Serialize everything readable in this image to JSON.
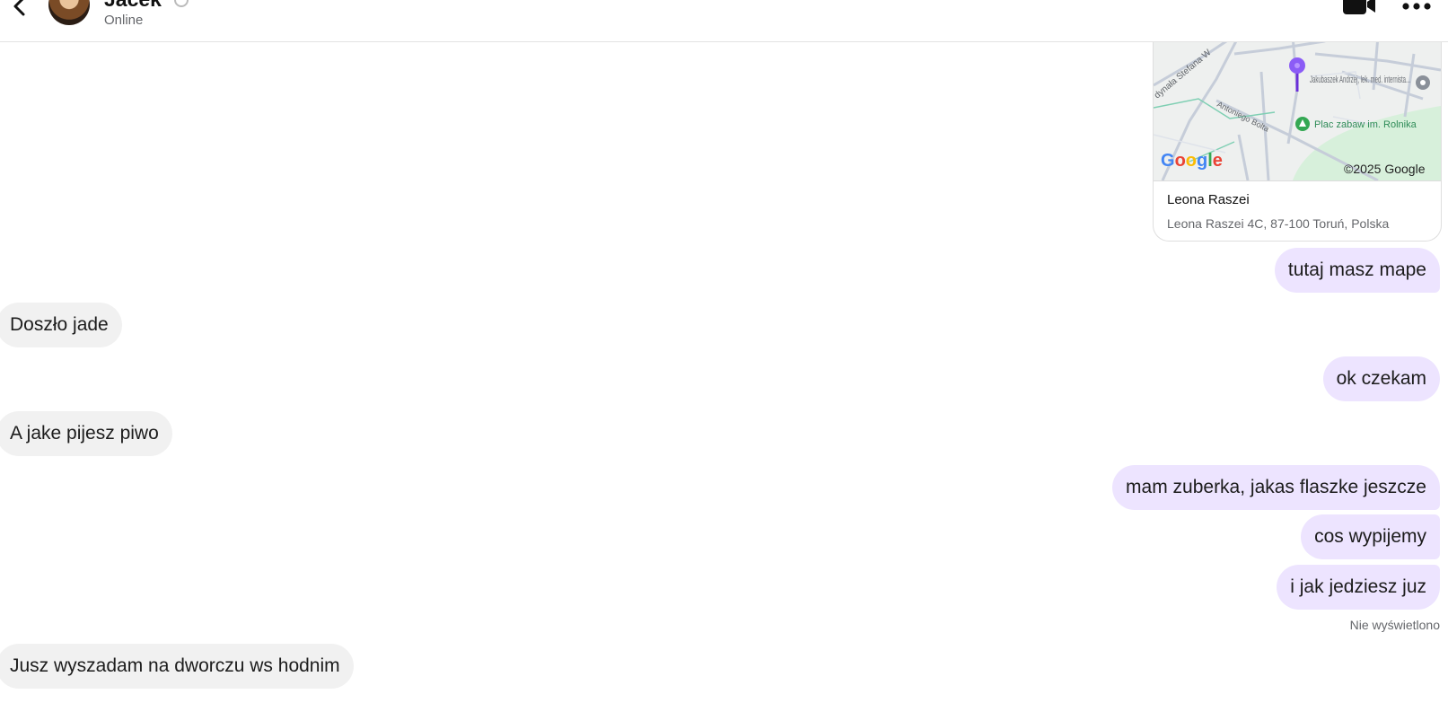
{
  "header": {
    "contact_name": "Jacek",
    "status": "Online",
    "back_icon": "chevron-left-icon",
    "video_icon": "video-camera-icon",
    "more_icon": "ellipsis-icon"
  },
  "map_card": {
    "title": "Leona Raszei",
    "address": "Leona Raszei 4C, 87-100 Toruń, Polska",
    "street_labels": [
      "dynała Stefana W",
      "Antoniego Bolta"
    ],
    "poi_doctor": "Jakubaszek Andrzej, lek. med. internista...",
    "poi_park": "Plac zabaw im. Rolnika",
    "copyright": "©2025 Google",
    "map_provider_logo": "Google"
  },
  "messages": [
    {
      "id": "m1",
      "direction": "out",
      "text": "tutaj masz mape"
    },
    {
      "id": "m2",
      "direction": "in",
      "text": "Doszło jade"
    },
    {
      "id": "m3",
      "direction": "out",
      "text": "ok czekam"
    },
    {
      "id": "m4",
      "direction": "in",
      "text": "A jake pijesz piwo"
    },
    {
      "id": "m5",
      "direction": "out",
      "text": "mam zuberka, jakas flaszke jeszcze"
    },
    {
      "id": "m6",
      "direction": "out",
      "text": "cos wypijemy"
    },
    {
      "id": "m7",
      "direction": "out",
      "text": "i jak jedziesz juz"
    },
    {
      "id": "m8",
      "direction": "in",
      "text": "Jusz wyszadam na dworczu ws hodnim"
    }
  ],
  "read_receipt": "Nie wyświetlono",
  "colors": {
    "outgoing_bubble": "#ede4ff",
    "incoming_bubble": "#f1f1f1",
    "map_pin": "#7b3ff2",
    "park_green": "#34a853"
  }
}
